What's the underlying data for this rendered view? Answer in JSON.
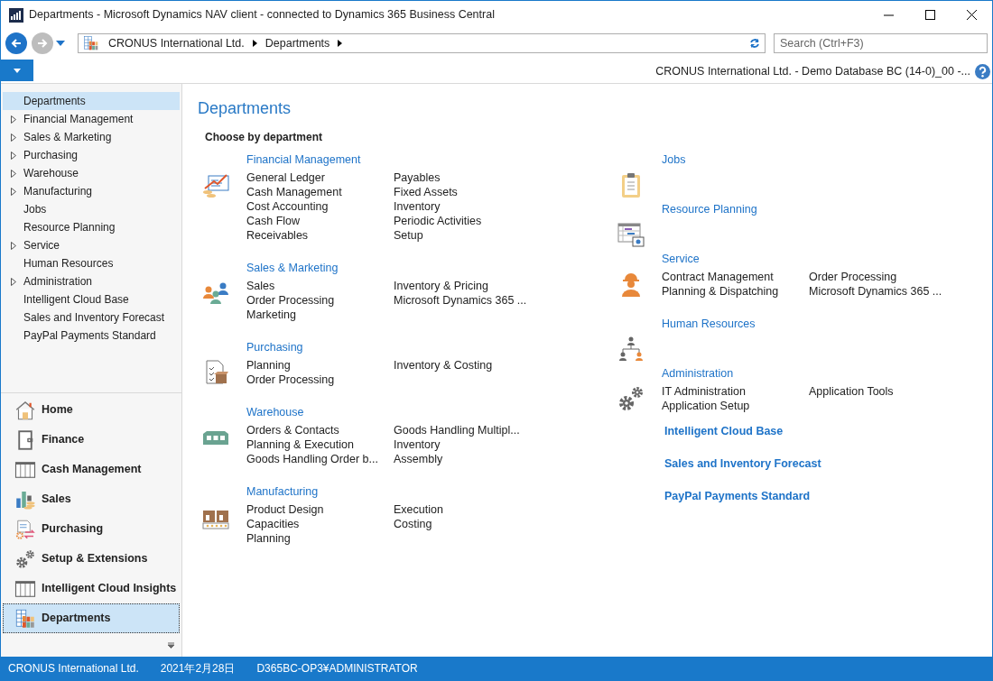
{
  "window": {
    "title": "Departments - Microsoft Dynamics NAV client - connected to Dynamics 365 Business Central"
  },
  "address_bar": {
    "crumbs": [
      "CRONUS International Ltd.",
      "Departments"
    ]
  },
  "search": {
    "placeholder": "Search (Ctrl+F3)"
  },
  "ribbon": {
    "company_info": "CRONUS International Ltd. - Demo Database BC (14-0)_00 -..."
  },
  "navigation_tree": [
    {
      "label": "Departments",
      "expandable": false,
      "selected": true
    },
    {
      "label": "Financial Management",
      "expandable": true,
      "selected": false
    },
    {
      "label": "Sales & Marketing",
      "expandable": true,
      "selected": false
    },
    {
      "label": "Purchasing",
      "expandable": true,
      "selected": false
    },
    {
      "label": "Warehouse",
      "expandable": true,
      "selected": false
    },
    {
      "label": "Manufacturing",
      "expandable": true,
      "selected": false
    },
    {
      "label": "Jobs",
      "expandable": false,
      "selected": false
    },
    {
      "label": "Resource Planning",
      "expandable": false,
      "selected": false
    },
    {
      "label": "Service",
      "expandable": true,
      "selected": false
    },
    {
      "label": "Human Resources",
      "expandable": false,
      "selected": false
    },
    {
      "label": "Administration",
      "expandable": true,
      "selected": false
    },
    {
      "label": "Intelligent Cloud Base",
      "expandable": false,
      "selected": false
    },
    {
      "label": "Sales and Inventory Forecast",
      "expandable": false,
      "selected": false
    },
    {
      "label": "PayPal Payments Standard",
      "expandable": false,
      "selected": false
    }
  ],
  "navigation_buttons": [
    {
      "kind": "home",
      "label": "Home",
      "selected": false
    },
    {
      "kind": "finance",
      "label": "Finance",
      "selected": false
    },
    {
      "kind": "grid",
      "label": "Cash Management",
      "selected": false
    },
    {
      "kind": "sales",
      "label": "Sales",
      "selected": false
    },
    {
      "kind": "purchasing",
      "label": "Purchasing",
      "selected": false
    },
    {
      "kind": "gears",
      "label": "Setup & Extensions",
      "selected": false
    },
    {
      "kind": "grid",
      "label": "Intelligent Cloud Insights",
      "selected": false
    },
    {
      "kind": "departments",
      "label": "Departments",
      "selected": true
    }
  ],
  "page": {
    "title": "Departments",
    "subtitle": "Choose by department",
    "columns": [
      [
        {
          "kind": "finance",
          "title": "Financial Management",
          "column_1": [
            "General Ledger",
            "Cash Management",
            "Cost Accounting",
            "Cash Flow",
            "Receivables"
          ],
          "column_2": [
            "Payables",
            "Fixed Assets",
            "Inventory",
            "Periodic Activities",
            "Setup"
          ]
        },
        {
          "kind": "people",
          "title": "Sales & Marketing",
          "column_1": [
            "Sales",
            "Order Processing",
            "Marketing"
          ],
          "column_2": [
            "Inventory & Pricing",
            "Microsoft Dynamics 365 ..."
          ]
        },
        {
          "kind": "purchasing",
          "title": "Purchasing",
          "column_1": [
            "Planning",
            "Order Processing"
          ],
          "column_2": [
            "Inventory & Costing"
          ]
        },
        {
          "kind": "warehouse",
          "title": "Warehouse",
          "column_1": [
            "Orders & Contacts",
            "Planning & Execution",
            "Goods Handling Order b..."
          ],
          "column_2": [
            "Goods Handling Multipl...",
            "Inventory",
            "Assembly"
          ]
        },
        {
          "kind": "manufacturing",
          "title": "Manufacturing",
          "column_1": [
            "Product Design",
            "Capacities",
            "Planning"
          ],
          "column_2": [
            "Execution",
            "Costing"
          ]
        }
      ],
      [
        {
          "kind": "jobs",
          "title": "Jobs"
        },
        {
          "kind": "resource",
          "title": "Resource Planning"
        },
        {
          "kind": "service",
          "title": "Service",
          "column_1": [
            "Contract Management",
            "Planning & Dispatching"
          ],
          "column_2": [
            "Order Processing",
            "Microsoft Dynamics 365 ..."
          ]
        },
        {
          "kind": "hr",
          "title": "Human Resources"
        },
        {
          "kind": "gears",
          "title": "Administration",
          "column_1": [
            "IT Administration",
            "Application Setup"
          ],
          "column_2": [
            "Application Tools"
          ]
        }
      ]
    ],
    "extra_links": [
      "Intelligent Cloud Base",
      "Sales and Inventory Forecast",
      "PayPal Payments Standard"
    ]
  },
  "status_bar": [
    "CRONUS International Ltd.",
    "2021年2月28日",
    "D365BC-OP3¥ADMINISTRATOR"
  ]
}
